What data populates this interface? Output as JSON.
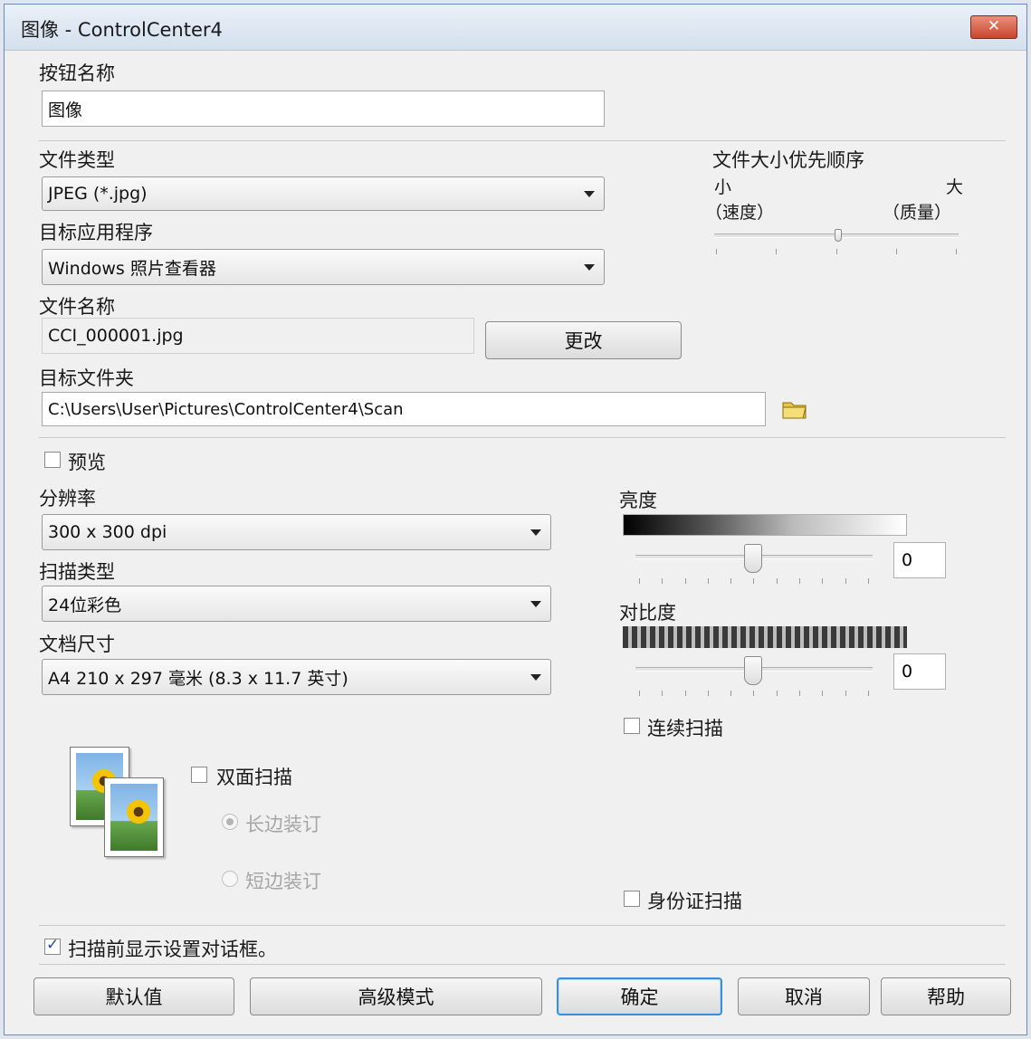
{
  "window": {
    "title": "图像 - ControlCenter4",
    "close_symbol": "✕"
  },
  "button_name": {
    "label": "按钮名称",
    "value": "图像"
  },
  "file_type": {
    "label": "文件类型",
    "value": "JPEG (*.jpg)"
  },
  "target_app": {
    "label": "目标应用程序",
    "value": "Windows 照片查看器"
  },
  "file_name": {
    "label": "文件名称",
    "value": "CCI_000001.jpg",
    "change_button": "更改"
  },
  "target_folder": {
    "label": "目标文件夹",
    "value": "C:\\Users\\User\\Pictures\\ControlCenter4\\Scan"
  },
  "file_size_priority": {
    "label": "文件大小优先顺序",
    "small": "小",
    "large": "大",
    "speed": "（速度）",
    "quality": "（质量）"
  },
  "preview": {
    "label": "预览",
    "checked": false
  },
  "resolution": {
    "label": "分辨率",
    "value": "300 x 300 dpi"
  },
  "scan_type": {
    "label": "扫描类型",
    "value": "24位彩色"
  },
  "document_size": {
    "label": "文档尺寸",
    "value": "A4 210 x 297 毫米 (8.3 x 11.7 英寸)"
  },
  "brightness": {
    "label": "亮度",
    "value": "0"
  },
  "contrast": {
    "label": "对比度",
    "value": "0"
  },
  "continuous_scan": {
    "label": "连续扫描",
    "checked": false
  },
  "duplex": {
    "label": "双面扫描",
    "checked": false,
    "long_edge": "长边装订",
    "short_edge": "短边装订"
  },
  "id_card_scan": {
    "label": "身份证扫描",
    "checked": false
  },
  "show_settings": {
    "label": "扫描前显示设置对话框。",
    "checked": true
  },
  "footer": {
    "default": "默认值",
    "advanced": "高级模式",
    "ok": "确定",
    "cancel": "取消",
    "help": "帮助"
  }
}
